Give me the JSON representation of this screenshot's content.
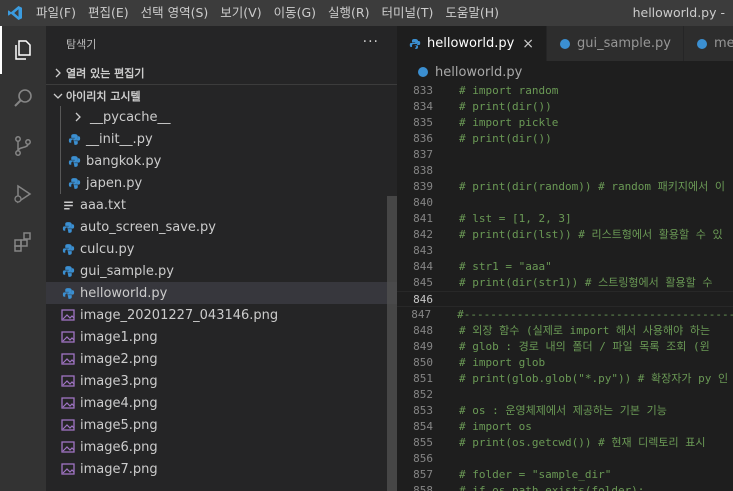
{
  "menu": {
    "items": [
      "파일(F)",
      "편집(E)",
      "선택 영역(S)",
      "보기(V)",
      "이동(G)",
      "실행(R)",
      "터미널(T)",
      "도움말(H)"
    ],
    "window_title": "helloworld.py -"
  },
  "activity_bar": {
    "icons": [
      "explorer-icon",
      "search-icon",
      "source-control-icon",
      "run-debug-icon",
      "extensions-icon"
    ]
  },
  "sidebar": {
    "title": "탐색기",
    "more": "···",
    "open_editors": "열려 있는 편집기",
    "folder": "아이리치 고시텔",
    "items": [
      {
        "label": "__pycache__",
        "type": "folder"
      },
      {
        "label": "__init__.py",
        "type": "python"
      },
      {
        "label": "bangkok.py",
        "type": "python"
      },
      {
        "label": "japen.py",
        "type": "python"
      },
      {
        "label": "aaa.txt",
        "type": "text"
      },
      {
        "label": "auto_screen_save.py",
        "type": "python"
      },
      {
        "label": "culcu.py",
        "type": "python"
      },
      {
        "label": "gui_sample.py",
        "type": "python"
      },
      {
        "label": "helloworld.py",
        "type": "python"
      },
      {
        "label": "image_20201227_043146.png",
        "type": "image"
      },
      {
        "label": "image1.png",
        "type": "image"
      },
      {
        "label": "image2.png",
        "type": "image"
      },
      {
        "label": "image3.png",
        "type": "image"
      },
      {
        "label": "image4.png",
        "type": "image"
      },
      {
        "label": "image5.png",
        "type": "image"
      },
      {
        "label": "image6.png",
        "type": "image"
      },
      {
        "label": "image7.png",
        "type": "image"
      }
    ]
  },
  "editor": {
    "tabs": [
      {
        "label": "helloworld.py",
        "close": "×"
      },
      {
        "label": "gui_sample.py"
      },
      {
        "label": "mem"
      }
    ],
    "breadcrumb": "helloworld.py",
    "lines": [
      {
        "num": "833",
        "text": "# import random"
      },
      {
        "num": "834",
        "text": "# print(dir())"
      },
      {
        "num": "835",
        "text": "# import pickle"
      },
      {
        "num": "836",
        "text": "# print(dir())"
      },
      {
        "num": "837",
        "text": ""
      },
      {
        "num": "838",
        "text": ""
      },
      {
        "num": "839",
        "text": "# print(dir(random)) # random 패키지에서 이"
      },
      {
        "num": "840",
        "text": ""
      },
      {
        "num": "841",
        "text": "# lst = [1, 2, 3]"
      },
      {
        "num": "842",
        "text": "# print(dir(lst)) # 리스트형에서 활용할 수 있"
      },
      {
        "num": "843",
        "text": ""
      },
      {
        "num": "844",
        "text": "# str1 = \"aaa\""
      },
      {
        "num": "845",
        "text": "# print(dir(str1)) # 스트링형에서 활용할 수"
      },
      {
        "num": "846",
        "text": ""
      },
      {
        "num": "847",
        "text": "#-------------------------------------------"
      },
      {
        "num": "848",
        "text": "# 외장 함수 (실제로 import 해서 사용해야 하는"
      },
      {
        "num": "849",
        "text": "# glob : 경로 내의 폴더 / 파일 목록 조회 (윈"
      },
      {
        "num": "850",
        "text": "# import glob"
      },
      {
        "num": "851",
        "text": "# print(glob.glob(\"*.py\")) # 확장자가 py 인"
      },
      {
        "num": "852",
        "text": ""
      },
      {
        "num": "853",
        "text": "# os : 운영체제에서 제공하는 기본 기능"
      },
      {
        "num": "854",
        "text": "# import os"
      },
      {
        "num": "855",
        "text": "# print(os.getcwd()) # 현재 디렉토리 표시"
      },
      {
        "num": "856",
        "text": ""
      },
      {
        "num": "857",
        "text": "# folder = \"sample_dir\""
      },
      {
        "num": "858",
        "text": "# if os.path.exists(folder):"
      }
    ],
    "current_line": "846"
  },
  "colors": {
    "comment": "#6a9955",
    "python_icon": "#3b8fd1",
    "accent": "#007acc"
  }
}
